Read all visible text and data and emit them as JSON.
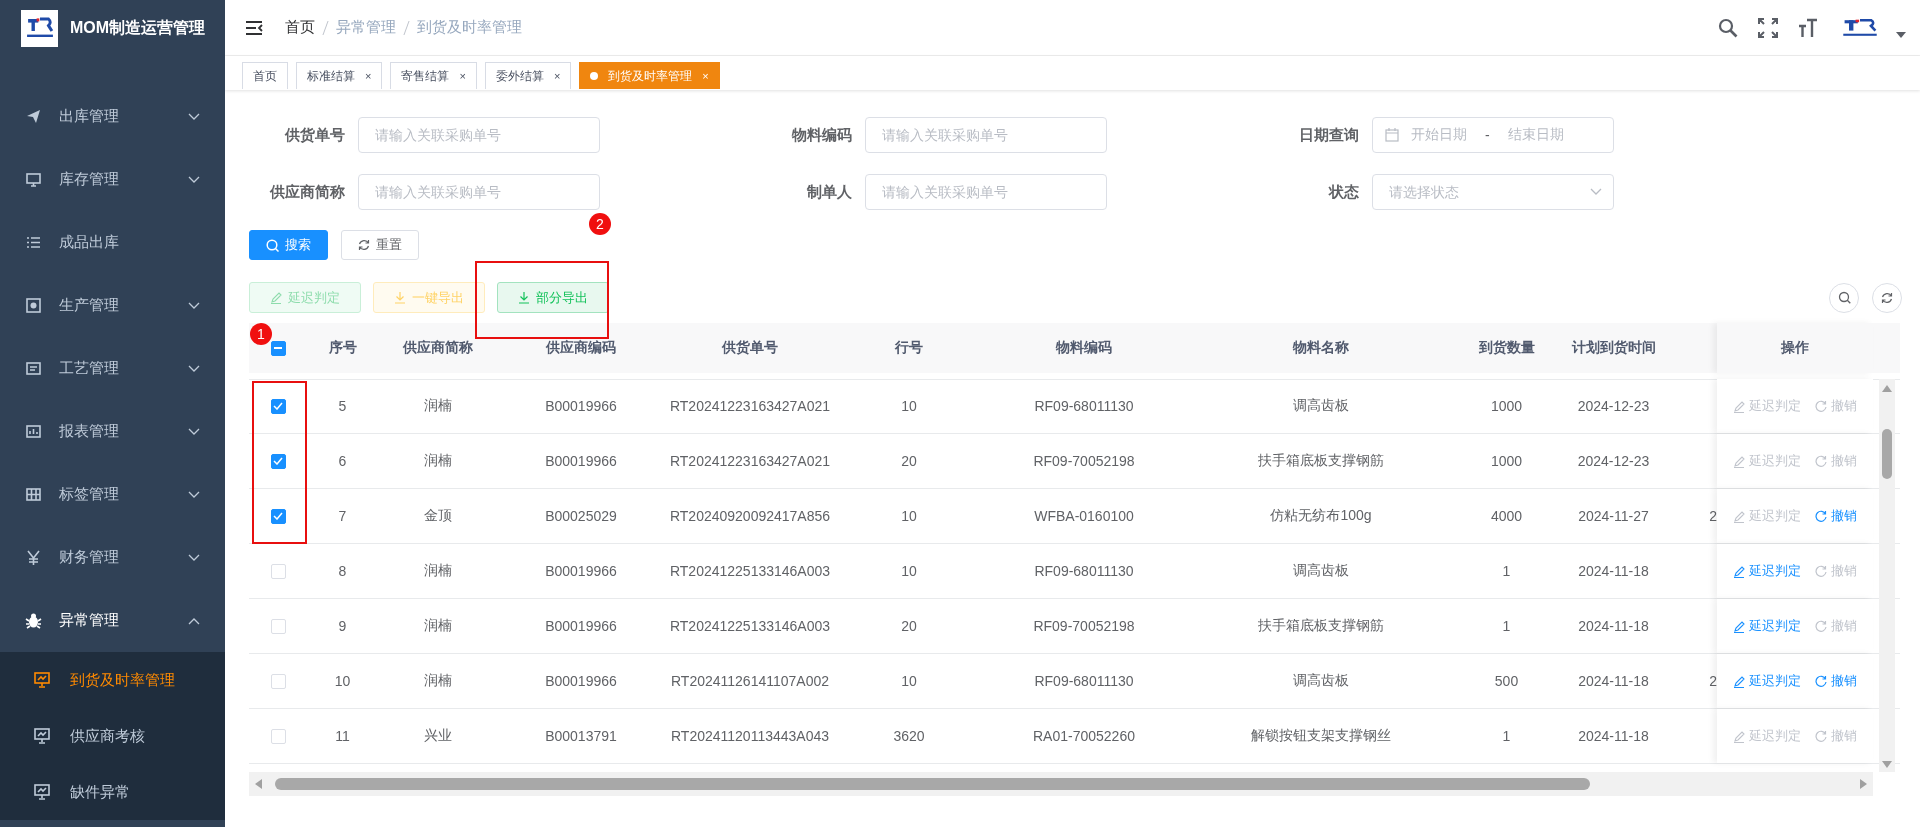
{
  "sidebar": {
    "title": "MOM制造运营管理",
    "items": [
      {
        "label": "出库管理",
        "has_submenu": true,
        "expanded": false
      },
      {
        "label": "库存管理",
        "has_submenu": true,
        "expanded": false
      },
      {
        "label": "成品出库",
        "has_submenu": false,
        "expanded": false
      },
      {
        "label": "生产管理",
        "has_submenu": true,
        "expanded": false
      },
      {
        "label": "工艺管理",
        "has_submenu": true,
        "expanded": false
      },
      {
        "label": "报表管理",
        "has_submenu": true,
        "expanded": false
      },
      {
        "label": "标签管理",
        "has_submenu": true,
        "expanded": false
      },
      {
        "label": "财务管理",
        "has_submenu": true,
        "expanded": false
      },
      {
        "label": "异常管理",
        "has_submenu": true,
        "expanded": true,
        "children": [
          {
            "label": "到货及时率管理",
            "selected": true
          },
          {
            "label": "供应商考核",
            "selected": false
          },
          {
            "label": "缺件异常",
            "selected": false
          }
        ]
      }
    ]
  },
  "breadcrumb": [
    "首页",
    "异常管理",
    "到货及时率管理"
  ],
  "tabs": [
    {
      "label": "首页",
      "closable": false,
      "selected": false
    },
    {
      "label": "标准结算",
      "closable": true,
      "selected": false
    },
    {
      "label": "寄售结算",
      "closable": true,
      "selected": false
    },
    {
      "label": "委外结算",
      "closable": true,
      "selected": false
    },
    {
      "label": "到货及时率管理",
      "closable": true,
      "selected": true
    }
  ],
  "tab_close": "×",
  "filters": [
    {
      "label": "供货单号",
      "kind": "text",
      "placeholder": "请输入关联采购单号"
    },
    {
      "label": "物料编码",
      "kind": "text",
      "placeholder": "请输入关联采购单号"
    },
    {
      "label": "日期查询",
      "kind": "daterange",
      "placeholder": "开始日期",
      "placeholder_end": "结束日期",
      "separator": "-"
    },
    {
      "label": "供应商简称",
      "kind": "text",
      "placeholder": "请输入关联采购单号"
    },
    {
      "label": "制单人",
      "kind": "text",
      "placeholder": "请输入关联采购单号"
    },
    {
      "label": "状态",
      "kind": "select",
      "placeholder": "请选择状态"
    }
  ],
  "search_buttons": [
    {
      "label": "搜索",
      "kind": "primary"
    },
    {
      "label": "重置",
      "kind": "plain"
    }
  ],
  "actions": [
    {
      "label": "延迟判定",
      "kind": "success",
      "disabled": true
    },
    {
      "label": "一键导出",
      "kind": "warning",
      "disabled": true
    },
    {
      "label": "部分导出",
      "kind": "success",
      "disabled": false
    }
  ],
  "table": {
    "select_all": {
      "indeterminate": true
    },
    "columns": [
      "序号",
      "供应商简称",
      "供应商编码",
      "供货单号",
      "行号",
      "物料编码",
      "物料名称",
      "到货数量",
      "计划到货时间",
      "操作"
    ],
    "rows": [
      {
        "checked": true,
        "cells": [
          "5",
          "润楠",
          "B00019966",
          "RT20241223163427A021",
          "10",
          "RF09-68011130",
          "调高齿板",
          "1000",
          "2024-12-23"
        ],
        "actions": [
          {
            "label": "延迟判定",
            "disabled": true
          },
          {
            "label": "撤销",
            "disabled": true
          }
        ]
      },
      {
        "checked": true,
        "cells": [
          "6",
          "润楠",
          "B00019966",
          "RT20241223163427A021",
          "20",
          "RF09-70052198",
          "扶手箱底板支撑钢筋",
          "1000",
          "2024-12-23"
        ],
        "actions": [
          {
            "label": "延迟判定",
            "disabled": true
          },
          {
            "label": "撤销",
            "disabled": true
          }
        ]
      },
      {
        "checked": true,
        "cells": [
          "7",
          "金顶",
          "B00025029",
          "RT20240920092417A856",
          "10",
          "WFBA-0160100",
          "仿粘无纺布100g",
          "4000",
          "2024-11-27"
        ],
        "column_11": "2",
        "actions": [
          {
            "label": "延迟判定",
            "disabled": true
          },
          {
            "label": "撤销",
            "disabled": false
          }
        ]
      },
      {
        "checked": false,
        "cells": [
          "8",
          "润楠",
          "B00019966",
          "RT20241225133146A003",
          "10",
          "RF09-68011130",
          "调高齿板",
          "1",
          "2024-11-18"
        ],
        "actions": [
          {
            "label": "延迟判定",
            "disabled": false
          },
          {
            "label": "撤销",
            "disabled": true
          }
        ]
      },
      {
        "checked": false,
        "cells": [
          "9",
          "润楠",
          "B00019966",
          "RT20241225133146A003",
          "20",
          "RF09-70052198",
          "扶手箱底板支撑钢筋",
          "1",
          "2024-11-18"
        ],
        "actions": [
          {
            "label": "延迟判定",
            "disabled": false
          },
          {
            "label": "撤销",
            "disabled": true
          }
        ]
      },
      {
        "checked": false,
        "cells": [
          "10",
          "润楠",
          "B00019966",
          "RT20241126141107A002",
          "10",
          "RF09-68011130",
          "调高齿板",
          "500",
          "2024-11-18"
        ],
        "column_11": "2",
        "actions": [
          {
            "label": "延迟判定",
            "disabled": false
          },
          {
            "label": "撤销",
            "disabled": false
          }
        ]
      },
      {
        "checked": false,
        "cells": [
          "11",
          "兴业",
          "B00013791",
          "RT20241120113443A043",
          "3620",
          "RA01-70052260",
          "解锁按钮支架支撑钢丝",
          "1",
          "2024-11-18"
        ],
        "actions": [
          {
            "label": "延迟判定",
            "disabled": true
          },
          {
            "label": "撤销",
            "disabled": true
          }
        ]
      }
    ]
  },
  "annotations": [
    {
      "label": "1"
    },
    {
      "label": "2"
    }
  ]
}
